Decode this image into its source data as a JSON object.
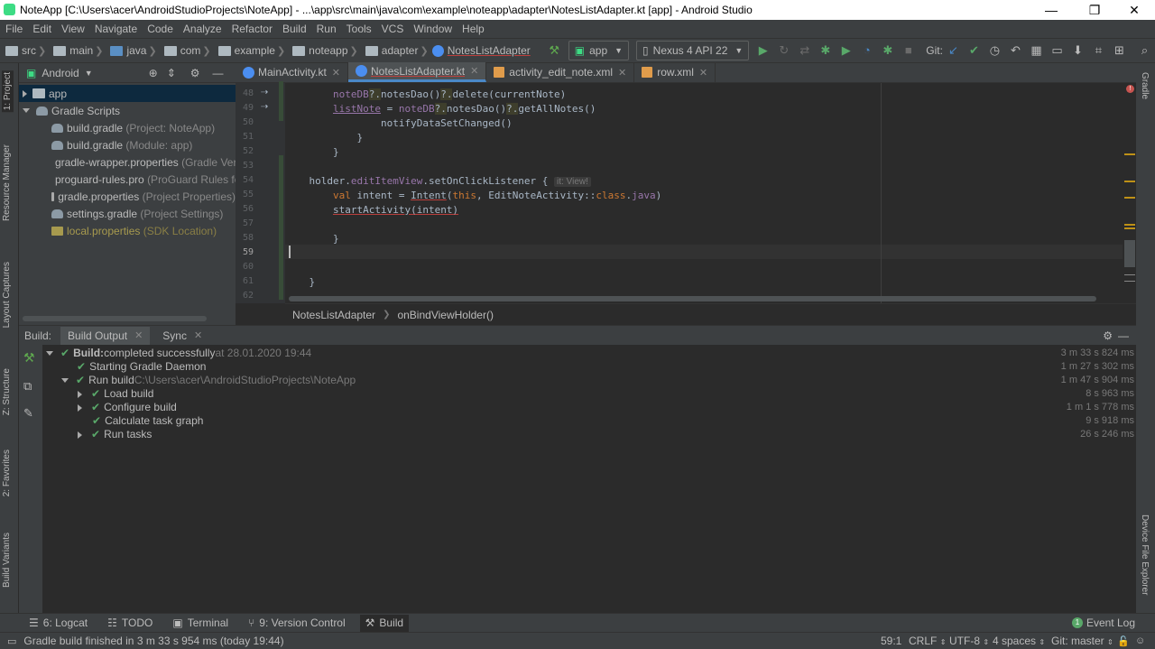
{
  "window": {
    "title": "NoteApp [C:\\Users\\acer\\AndroidStudioProjects\\NoteApp] - ...\\app\\src\\main\\java\\com\\example\\noteapp\\adapter\\NotesListAdapter.kt [app] - Android Studio",
    "minimize": "—",
    "maximize": "❐",
    "close": "✕"
  },
  "menu": [
    "File",
    "Edit",
    "View",
    "Navigate",
    "Code",
    "Analyze",
    "Refactor",
    "Build",
    "Run",
    "Tools",
    "VCS",
    "Window",
    "Help"
  ],
  "nav": {
    "crumbs": [
      "src",
      "main",
      "java",
      "com",
      "example",
      "noteapp",
      "adapter"
    ],
    "file": "NotesListAdapter",
    "run_config": "app",
    "device": "Nexus 4 API 22",
    "git_label": "Git:"
  },
  "left_strip": [
    "1: Project",
    "Resource Manager",
    "Layout Captures",
    "Z: Structure",
    "2: Favorites",
    "Build Variants"
  ],
  "right_strip": [
    "Gradle",
    "Device File Explorer"
  ],
  "project": {
    "view": "Android",
    "tree": [
      {
        "label": "app",
        "note": "",
        "level": 0
      },
      {
        "label": "Gradle Scripts",
        "note": "",
        "level": 0
      },
      {
        "label": "build.gradle",
        "note": "(Project: NoteApp)",
        "level": 1
      },
      {
        "label": "build.gradle",
        "note": "(Module: app)",
        "level": 1
      },
      {
        "label": "gradle-wrapper.properties",
        "note": "(Gradle Ver",
        "level": 1
      },
      {
        "label": "proguard-rules.pro",
        "note": "(ProGuard Rules fo",
        "level": 1
      },
      {
        "label": "gradle.properties",
        "note": "(Project Properties)",
        "level": 1
      },
      {
        "label": "settings.gradle",
        "note": "(Project Settings)",
        "level": 1
      },
      {
        "label": "local.properties",
        "note": "(SDK Location)",
        "level": 1
      }
    ]
  },
  "tabs": [
    {
      "label": "MainActivity.kt"
    },
    {
      "label": "NotesListAdapter.kt"
    },
    {
      "label": "activity_edit_note.xml"
    },
    {
      "label": "row.xml"
    }
  ],
  "editor": {
    "line_numbers": [
      "48",
      "49",
      "50",
      "51",
      "52",
      "53",
      "54",
      "55",
      "56",
      "57",
      "58",
      "59",
      "60",
      "61",
      "62"
    ],
    "lines": [
      "                noteDB?.notesDao()?.delete(currentNote)",
      "                listNote = noteDB?.notesDao()?.getAllNotes()",
      "                notifyDataSetChanged()",
      "            }",
      "        }",
      "",
      "        holder.editItemView.setOnClickListener {",
      "            val intent = Intent(this, EditNoteActivity::class.java)",
      "            startActivity(intent)",
      "",
      "        }",
      "",
      "",
      "    }",
      ""
    ],
    "hint": "it: View!",
    "breadcrumb": [
      "NotesListAdapter",
      "onBindViewHolder()"
    ]
  },
  "build": {
    "label": "Build:",
    "tabs": [
      "Build Output",
      "Sync"
    ],
    "rows": [
      {
        "level": 0,
        "expand": "down",
        "text": "Build:",
        "bold_rest": " completed successfully",
        "extra": " at 28.01.2020 19:44",
        "time": "3 m 33 s 824 ms"
      },
      {
        "level": 1,
        "expand": "",
        "text": "Starting Gradle Daemon",
        "bold_rest": "",
        "extra": "",
        "time": "1 m 27 s 302 ms"
      },
      {
        "level": 1,
        "expand": "down",
        "text": "Run build",
        "bold_rest": "",
        "extra": " C:\\Users\\acer\\AndroidStudioProjects\\NoteApp",
        "time": "1 m 47 s 904 ms"
      },
      {
        "level": 2,
        "expand": "right",
        "text": "Load build",
        "bold_rest": "",
        "extra": "",
        "time": "8 s 963 ms"
      },
      {
        "level": 2,
        "expand": "right",
        "text": "Configure build",
        "bold_rest": "",
        "extra": "",
        "time": "1 m 1 s 778 ms"
      },
      {
        "level": 2,
        "expand": "",
        "text": "Calculate task graph",
        "bold_rest": "",
        "extra": "",
        "time": "9 s 918 ms"
      },
      {
        "level": 2,
        "expand": "right",
        "text": "Run tasks",
        "bold_rest": "",
        "extra": "",
        "time": "26 s 246 ms"
      }
    ]
  },
  "bottom_tabs": [
    "6: Logcat",
    "TODO",
    "Terminal",
    "9: Version Control",
    "Build"
  ],
  "event_log": "Event Log",
  "status": {
    "message": "Gradle build finished in 3 m 33 s 954 ms (today 19:44)",
    "position": "59:1",
    "line_sep": "CRLF",
    "encoding": "UTF-8",
    "indent": "4 spaces",
    "git": "Git: master"
  }
}
